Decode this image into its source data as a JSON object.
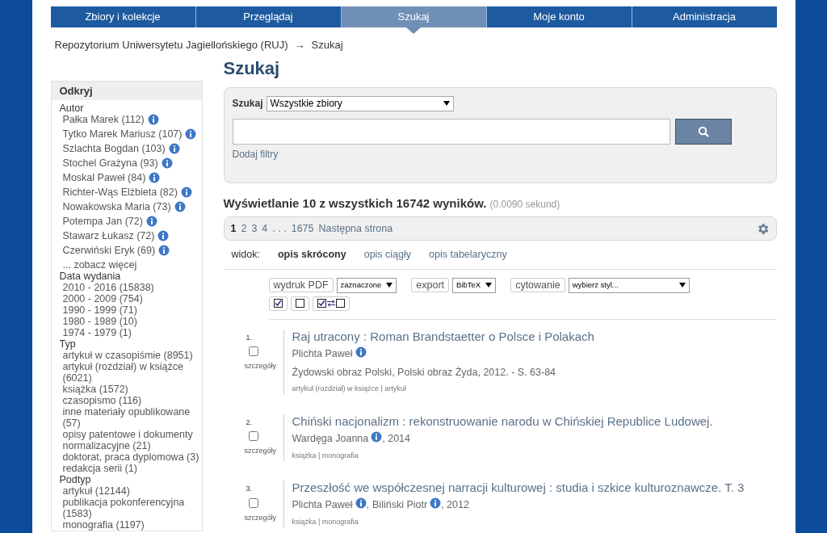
{
  "nav": [
    {
      "label": "Zbiory i kolekcje",
      "selected": false
    },
    {
      "label": "Przeglądaj",
      "selected": false
    },
    {
      "label": "Szukaj",
      "selected": true
    },
    {
      "label": "Moje konto",
      "selected": false
    },
    {
      "label": "Administracja",
      "selected": false
    }
  ],
  "breadcrumb": {
    "items": [
      "Repozytorium Uniwersytetu Jagiellońskiego (RUJ)",
      "Szukaj"
    ],
    "separator": "→"
  },
  "sidebar": {
    "title": "Odkryj",
    "groups": [
      {
        "title": "Autor",
        "items": [
          {
            "label": "Pałka Marek (112)",
            "info": true
          },
          {
            "label": "Tytko Marek Mariusz (107)",
            "info": true
          },
          {
            "label": "Szlachta Bogdan (103)",
            "info": true
          },
          {
            "label": "Stochel Grażyna (93)",
            "info": true
          },
          {
            "label": "Moskal Paweł (84)",
            "info": true
          },
          {
            "label": "Richter-Wąs Elżbieta (82)",
            "info": true
          },
          {
            "label": "Nowakowska Maria (73)",
            "info": true
          },
          {
            "label": "Potempa Jan (72)",
            "info": true
          },
          {
            "label": "Stawarz Łukasz (72)",
            "info": true
          },
          {
            "label": "Czerwiński Eryk (69)",
            "info": true
          }
        ],
        "more": "... zobacz więcej"
      },
      {
        "title": "Data wydania",
        "items": [
          {
            "label": "2010 - 2016 (15838)",
            "info": false
          },
          {
            "label": "2000 - 2009 (754)",
            "info": false
          },
          {
            "label": "1990 - 1999 (71)",
            "info": false
          },
          {
            "label": "1980 - 1989 (10)",
            "info": false
          },
          {
            "label": "1974 - 1979 (1)",
            "info": false
          }
        ]
      },
      {
        "title": "Typ",
        "items": [
          {
            "label": "artykuł w czasopiśmie (8951)",
            "info": false
          },
          {
            "label": "artykuł (rozdział) w książce (6021)",
            "info": false
          },
          {
            "label": "książka (1572)",
            "info": false
          },
          {
            "label": "czasopismo (116)",
            "info": false
          },
          {
            "label": "inne materiały opublikowane (57)",
            "info": false
          },
          {
            "label": "opisy patentowe i dokumenty normalizacyjne (21)",
            "info": false
          },
          {
            "label": "doktorat, praca dyplomowa (3)",
            "info": false
          },
          {
            "label": "redakcja serii (1)",
            "info": false
          }
        ]
      },
      {
        "title": "Podtyp",
        "items": [
          {
            "label": "artykuł (12144)",
            "info": false
          },
          {
            "label": "publikacja pokonferencyjna (1583)",
            "info": false
          },
          {
            "label": "monografia (1197)",
            "info": false
          }
        ]
      }
    ]
  },
  "page_title": "Szukaj",
  "search": {
    "scope_label": "Szukaj",
    "scope_value": "Wszystkie zbiory",
    "add_filters": "Dodaj filtry"
  },
  "summary": {
    "text": "Wyświetlanie 10 z wszystkich 16742 wyników.",
    "time": "(0.0090 sekund)"
  },
  "pager": [
    {
      "label": "1",
      "selected": true
    },
    {
      "label": "2",
      "selected": false
    },
    {
      "label": "3",
      "selected": false
    },
    {
      "label": "4",
      "selected": false
    },
    {
      "label": ". . .",
      "selected": false
    },
    {
      "label": "1675",
      "selected": false
    },
    {
      "label": "Następna strona",
      "selected": false
    }
  ],
  "views": {
    "label": "widok:",
    "options": [
      {
        "label": "opis skrócony",
        "selected": true
      },
      {
        "label": "opis ciągły",
        "selected": false
      },
      {
        "label": "opis tabelaryczny",
        "selected": false
      }
    ]
  },
  "actions": [
    {
      "button": "wydruk PDF",
      "select": "zaznaczone"
    },
    {
      "button": "export",
      "select": "BibTeX"
    },
    {
      "button": "cytowanie",
      "select": "wybierz styl..."
    }
  ],
  "author_separator": ",",
  "results": [
    {
      "number": "1.",
      "checked": false,
      "details": "szczegóły",
      "title": "Raj utracony : Roman Brandstaetter o Polsce i Polakach",
      "authors": [
        "Plichta Paweł"
      ],
      "source": "Żydowski obraz Polski, Polski obraz Żyda, 2012. - S. 63-84",
      "tags": "artykuł (rozdział) w książce | artykuł"
    },
    {
      "number": "2.",
      "checked": false,
      "details": "szczegóły",
      "title": "Chiński nacjonalizm : rekonstruowanie narodu w Chińskiej Republice Ludowej.",
      "authors": [
        "Wardęga Joanna"
      ],
      "after_authors": ", 2014",
      "tags": "książka | monografia"
    },
    {
      "number": "3.",
      "checked": false,
      "details": "szczegóły",
      "title": "Przeszłość we współczesnej narracji kulturowej : studia i szkice kulturoznawcze. T. 3",
      "authors": [
        "Plichta Paweł",
        "Biliński Piotr"
      ],
      "after_authors": ", 2012",
      "tags": "książka | monografia"
    }
  ]
}
